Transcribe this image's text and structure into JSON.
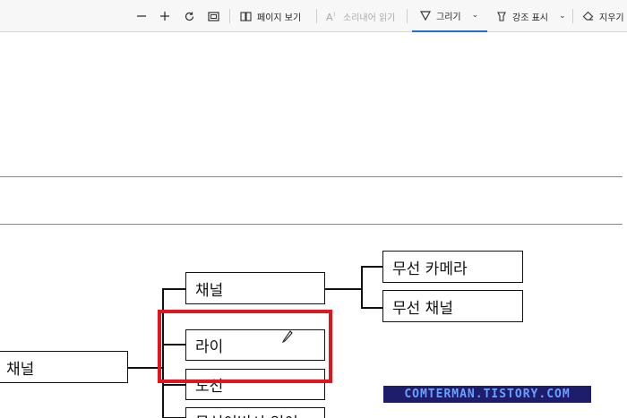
{
  "toolbar": {
    "zoom_out_icon": "minus-icon",
    "zoom_in_icon": "plus-icon",
    "rotate_icon": "rotate-icon",
    "fit_icon": "fit-page-icon",
    "page_view_label": "페이지 보기",
    "read_aloud_label": "소리내어 읽기",
    "draw_label": "그리기",
    "highlight_label": "강조 표시",
    "erase_label": "지우기"
  },
  "mindmap": {
    "root_label": "채널",
    "branches": [
      "채널",
      "라이",
      "도선",
      "무선이버시 인이"
    ],
    "leaves": [
      "무선 카메라",
      "무선 채널"
    ]
  },
  "watermark": "COMTERMAN.TISTORY.COM",
  "colors": {
    "annotation": "#e3141b",
    "active_tab": "#1f6fd6",
    "watermark_bg": "#1d1d6b",
    "watermark_text": "#6ba0ff"
  }
}
